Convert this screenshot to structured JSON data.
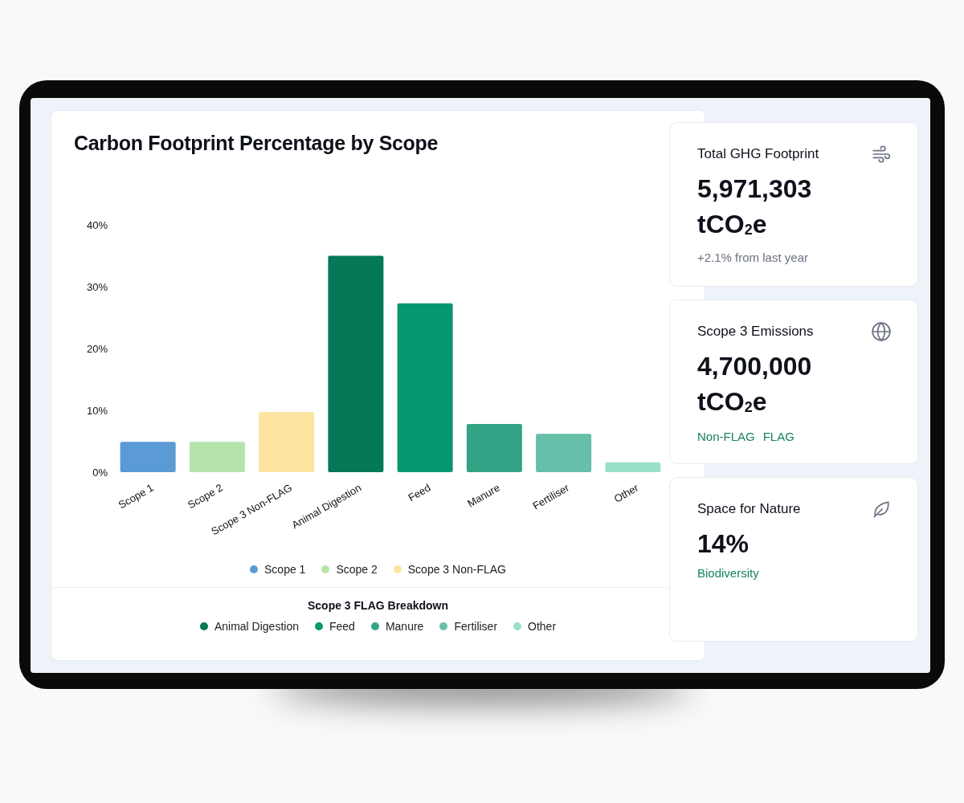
{
  "chart_card": {
    "title": "Carbon Footprint Percentage by Scope",
    "chart_data": {
      "type": "bar",
      "categories": [
        "Scope 1",
        "Scope 2",
        "Scope 3 Non-FLAG",
        "Animal Digestion",
        "Feed",
        "Manure",
        "Fertiliser",
        "Other"
      ],
      "values": [
        4.9,
        4.9,
        9.7,
        35,
        27.3,
        7.8,
        6.2,
        1.6
      ],
      "ylim": [
        0,
        40
      ],
      "yticks": [
        {
          "value": 0,
          "label": "0%"
        },
        {
          "value": 10,
          "label": "10%"
        },
        {
          "value": 20,
          "label": "20%"
        },
        {
          "value": 30,
          "label": "30%"
        },
        {
          "value": 40,
          "label": "40%"
        }
      ]
    },
    "legend": [
      {
        "label": "Scope 1",
        "color": "#5b9bd5"
      },
      {
        "label": "Scope 2",
        "color": "#b5e4aa"
      },
      {
        "label": "Scope 3 Non-FLAG",
        "color": "#fde3a0"
      }
    ],
    "breakdown": {
      "title": "Scope 3 FLAG Breakdown",
      "items": [
        {
          "label": "Animal Digestion",
          "color": "#047857"
        },
        {
          "label": "Feed",
          "color": "#07976f"
        },
        {
          "label": "Manure",
          "color": "#34a385"
        },
        {
          "label": "Fertiliser",
          "color": "#66bfa8"
        },
        {
          "label": "Other",
          "color": "#99dfc9"
        }
      ]
    }
  },
  "stat_cards": [
    {
      "title": "Total GHG Footprint",
      "value": "5,971,303 tCO$_{2}$e",
      "note": "+2.1% from last year"
    },
    {
      "title": "Scope 3 Emissions",
      "value": "4,700,000 tCO$_{2}$e",
      "tags": [
        "Non-FLAG",
        "FLAG"
      ]
    },
    {
      "title": "Space for Nature",
      "value": "14%",
      "tags": [
        "Biodiversity"
      ]
    }
  ]
}
